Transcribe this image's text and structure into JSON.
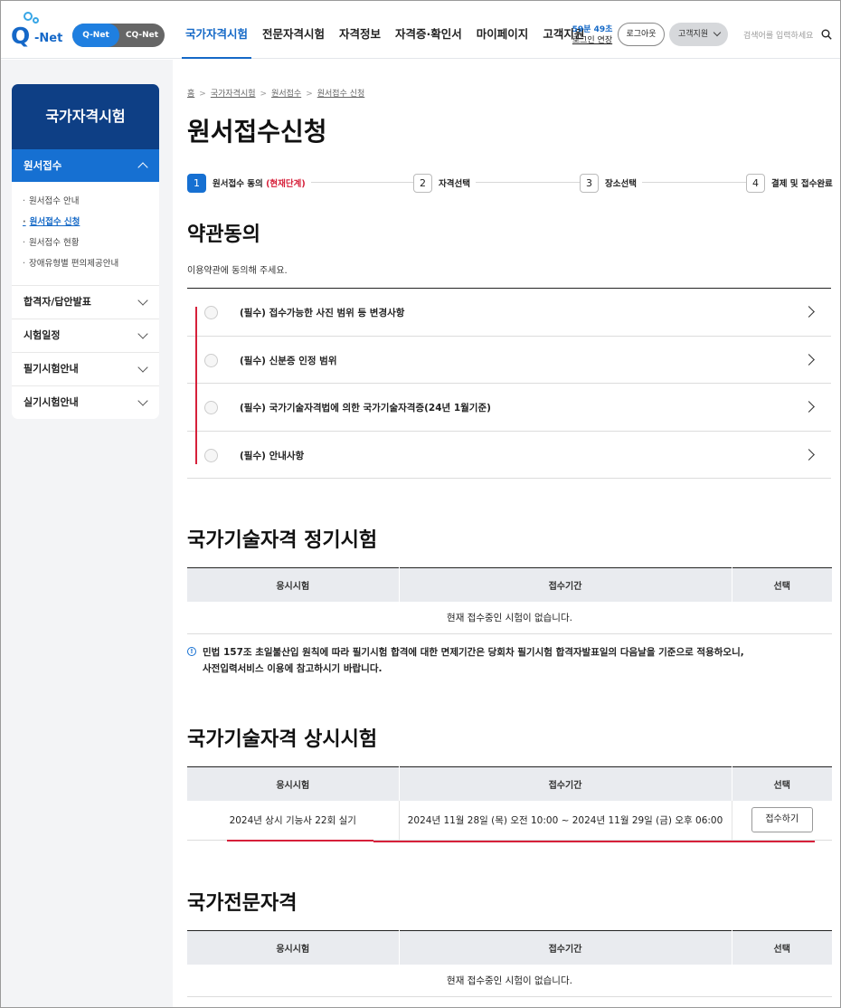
{
  "header": {
    "logo_text": "Net",
    "logo_q": "Q",
    "toggle": {
      "active": "Q-Net",
      "inactive": "CQ-Net"
    },
    "gnb": [
      "국가자격시험",
      "전문자격시험",
      "자격정보",
      "자격증·확인서",
      "마이페이지",
      "고객지원"
    ],
    "timer": {
      "time": "59분 49초",
      "extend": "로그인 연장"
    },
    "logout": "로그아웃",
    "customer_service": "고객지원",
    "search_placeholder": "검색어를 입력하세요"
  },
  "lnb": {
    "title": "국가자격시험",
    "active_menu": "원서접수",
    "sub_items": [
      "원서접수 안내",
      "원서접수 신청",
      "원서접수 현황",
      "장애유형별 편의제공안내"
    ],
    "menus": [
      "합격자/답안발표",
      "시험일정",
      "필기시험안내",
      "실기시험안내"
    ]
  },
  "breadcrumb": [
    "홈",
    "국가자격시험",
    "원서접수",
    "원서접수 신청"
  ],
  "page_title": "원서접수신청",
  "steps": [
    {
      "num": "1",
      "label": "원서접수 동의",
      "current": "(현재단계)"
    },
    {
      "num": "2",
      "label": "자격선택"
    },
    {
      "num": "3",
      "label": "장소선택"
    },
    {
      "num": "4",
      "label": "결제 및 접수완료"
    }
  ],
  "terms": {
    "title": "약관동의",
    "desc": "이용약관에 동의해 주세요.",
    "items": [
      "(필수) 접수가능한 사진 범위 등 변경사항",
      "(필수) 신분증 인정 범위",
      "(필수) 국가기술자격법에 의한 국가기술자격증(24년 1월기준)",
      "(필수) 안내사항"
    ]
  },
  "regular": {
    "title": "국가기술자격 정기시험",
    "headers": [
      "응시시험",
      "접수기간",
      "선택"
    ],
    "empty": "현재 접수중인 시험이 없습니다.",
    "notice_line1": "민법 157조 초일불산입 원칙에 따라 필기시험 합격에 대한 면제기간은 당회차 필기시험 합격자발표일의 다음날을 기준으로 적용하오니,",
    "notice_line2": "사전입력서비스 이용에 참고하시기 바랍니다.",
    "notice_icon": "!"
  },
  "continuous": {
    "title": "국가기술자격 상시시험",
    "headers": [
      "응시시험",
      "접수기간",
      "선택"
    ],
    "row": {
      "exam": "2024년 상시 기능사 22회 실기",
      "period": "2024년 11월 28일 (목) 오전 10:00 ~ 2024년 11월 29일 (금) 오후 06:00",
      "button": "접수하기"
    }
  },
  "professional": {
    "title": "국가전문자격",
    "headers": [
      "응시시험",
      "접수기간",
      "선택"
    ],
    "empty": "현재 접수중인 시험이 없습니다."
  },
  "colors": {
    "primary": "#1670d2",
    "navy": "#0e3f85",
    "accent_red": "#d6203a"
  }
}
